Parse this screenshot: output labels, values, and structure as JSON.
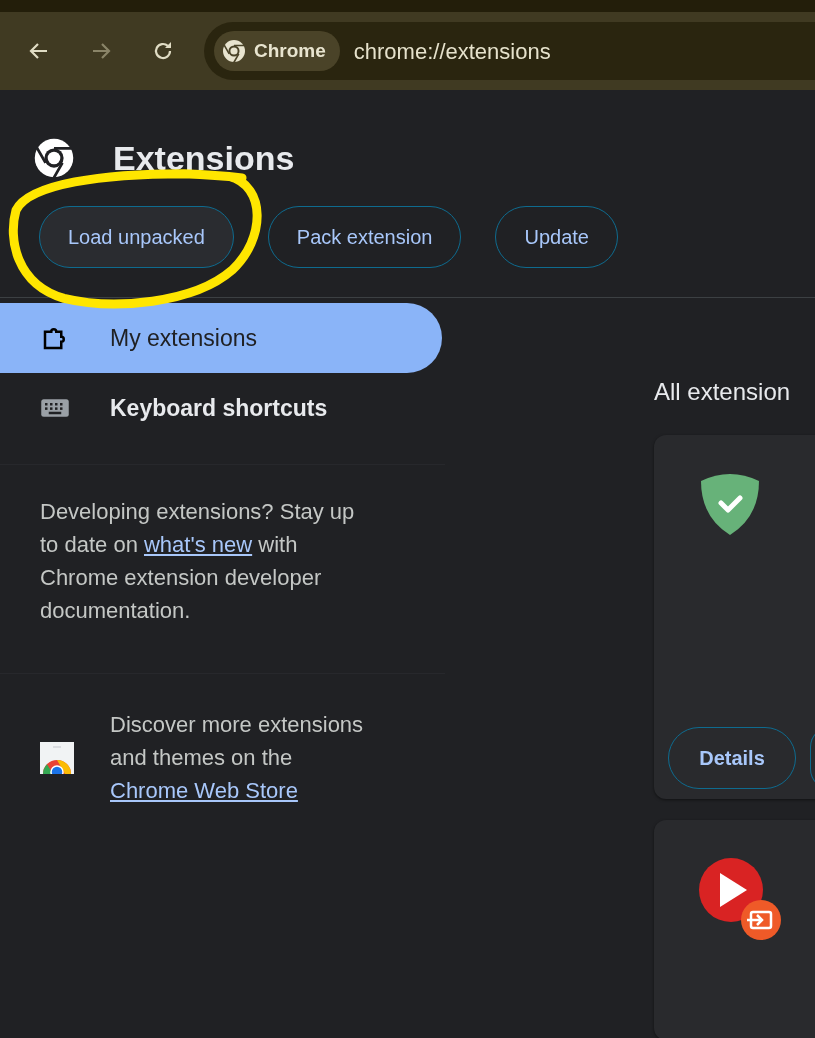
{
  "toolbar": {
    "chip": "Chrome",
    "url": "chrome://extensions",
    "forward_disabled": true
  },
  "header": {
    "title": "Extensions"
  },
  "actions": [
    "Load unpacked",
    "Pack extension",
    "Update"
  ],
  "sidebar": {
    "items": [
      {
        "label": "My extensions",
        "kind": "puzzle",
        "selected": true
      },
      {
        "label": "Keyboard shortcuts",
        "kind": "keyboard",
        "selected": false
      }
    ],
    "dev_note": {
      "before": "Developing extensions? Stay up to date on ",
      "link": "what's new",
      "after": " with Chrome extension developer documentation."
    },
    "store_note": {
      "text": "Discover more extensions and themes on the",
      "link": "Chrome Web Store"
    }
  },
  "main": {
    "heading": "All extension",
    "cards": [
      {
        "kind": "shield",
        "button": "Details"
      },
      {
        "kind": "play"
      }
    ]
  },
  "annotation": {
    "kind": "circle"
  }
}
